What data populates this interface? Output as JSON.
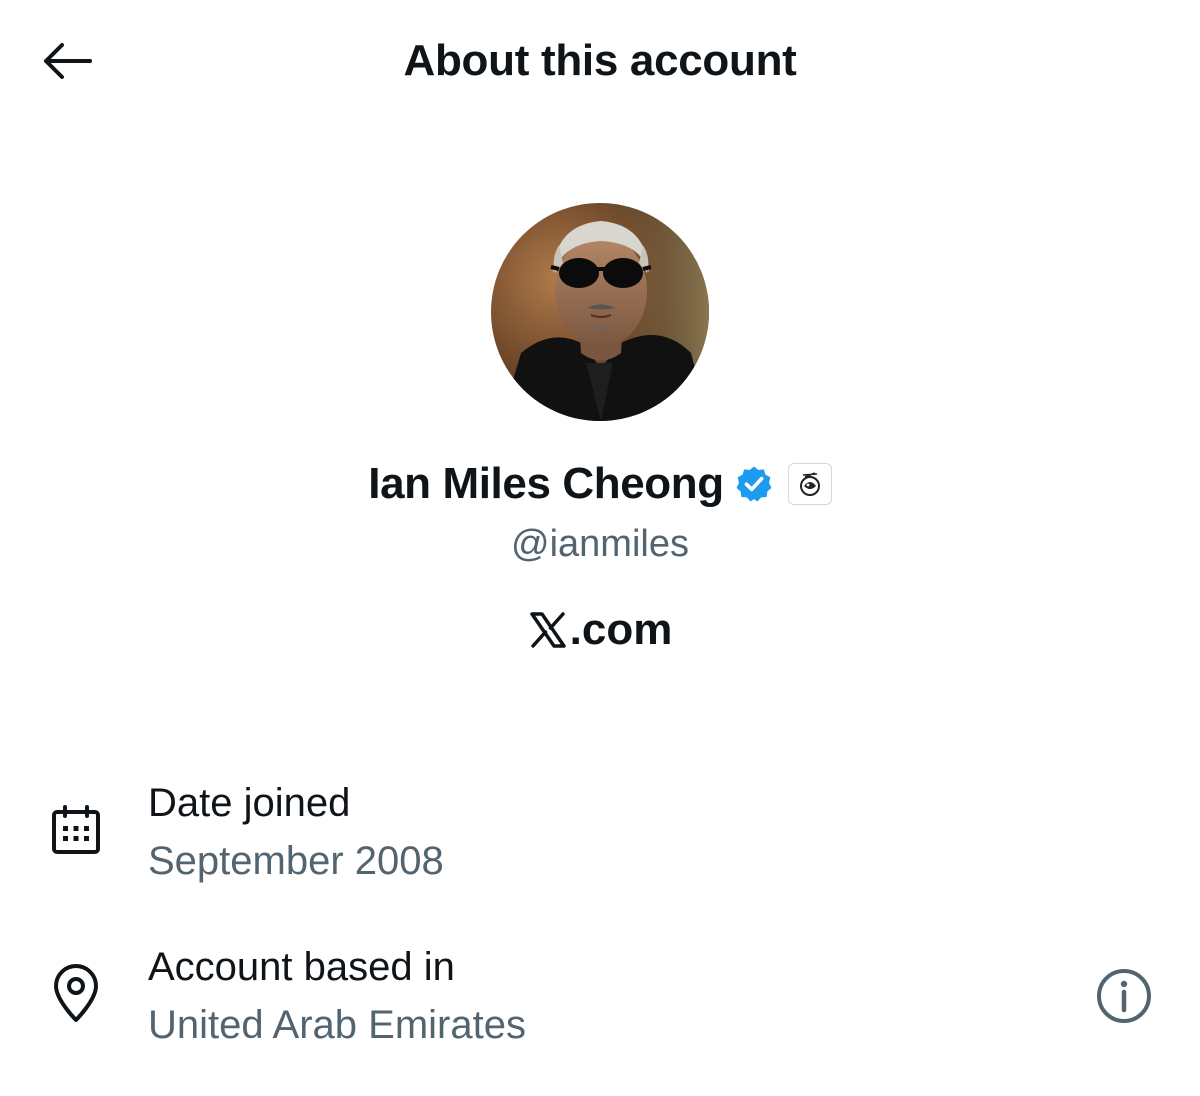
{
  "header": {
    "title": "About this account",
    "back_icon": "arrow-left-icon"
  },
  "profile": {
    "avatar_icon": "profile-photo",
    "display_name": "Ian Miles Cheong",
    "verified_icon": "verified-badge-icon",
    "verified_color": "#1d9bf0",
    "affiliate_icon": "affiliate-badge-icon",
    "handle": "@ianmiles",
    "affiliation": {
      "logo_icon": "x-logo-icon",
      "label": ".com"
    }
  },
  "details": {
    "date_joined": {
      "icon": "calendar-icon",
      "label": "Date joined",
      "value": "September 2008"
    },
    "based_in": {
      "icon": "location-pin-icon",
      "label": "Account based in",
      "value": "United Arab Emirates",
      "info_icon": "info-icon"
    }
  },
  "colors": {
    "primary_text": "#0f1419",
    "secondary_text": "#536471",
    "background": "#ffffff"
  }
}
